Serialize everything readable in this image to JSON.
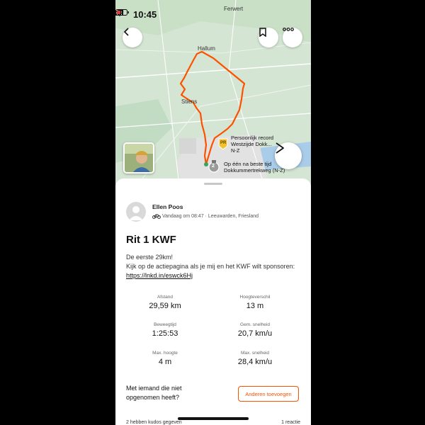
{
  "status": {
    "time": "10:45"
  },
  "map": {
    "labels": {
      "ferwert": "Ferwert",
      "hallum": "Hallum",
      "stiens": "Stiens"
    },
    "record1": {
      "line1": "Persoonlijk record",
      "line2": "Westzijde Dokk...",
      "line3": "N-Z"
    },
    "record2": {
      "line1": "Op één na beste tijd",
      "line2": "Dokkummertrekweg (N-Z)"
    },
    "badge_pr": "PR",
    "badge_2": "2",
    "route_color": "#fc5200"
  },
  "activity": {
    "athlete": "Ellen Poos",
    "meta": "Vandaag om 08:47 · Leeuwarden, Friesland",
    "title": "Rit 1 KWF",
    "desc_text": "De eerste 29km!\nKijk op de actiepagina als je mij en het KWF wilt sponsoren: ",
    "desc_link": "https://lnkd.in/eswck6Hj",
    "stats": {
      "distance_label": "Afstand",
      "distance_value": "29,59 km",
      "elev_label": "Hoogteverschil",
      "elev_value": "13 m",
      "moving_label": "Beweegtijd",
      "moving_value": "1:25:53",
      "avg_label": "Gem. snelheid",
      "avg_value": "20,7 km/u",
      "maxelev_label": "Max. hoogte",
      "maxelev_value": "4 m",
      "maxspeed_label": "Max. snelheid",
      "maxspeed_value": "28,4 km/u"
    },
    "question": "Met iemand die niet opgenomen heeft?",
    "add_button": "Anderen toevoegen",
    "bottom_left": "2 hebben kudos gegeven",
    "bottom_right": "1 reactie"
  }
}
